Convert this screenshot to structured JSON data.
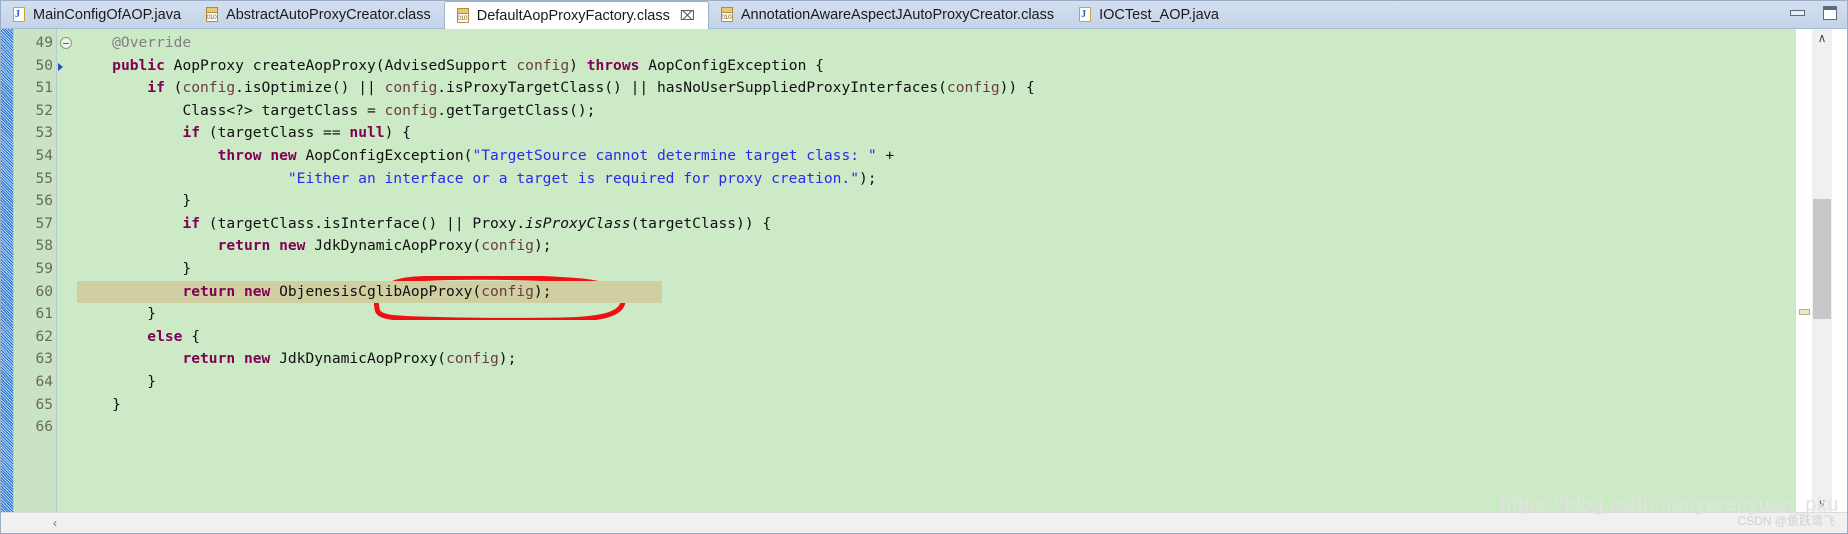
{
  "window": {
    "minimize_label": "Minimize",
    "maximize_label": "Maximize"
  },
  "tabs": [
    {
      "label": "MainConfigOfAOP.java",
      "icon": "java-file-icon",
      "active": false,
      "closable": false
    },
    {
      "label": "AbstractAutoProxyCreator.class",
      "icon": "class-file-icon",
      "active": false,
      "closable": false
    },
    {
      "label": "DefaultAopProxyFactory.class",
      "icon": "class-file-icon",
      "active": true,
      "closable": true,
      "close_glyph": "⌧"
    },
    {
      "label": "AnnotationAwareAspectJAutoProxyCreator.class",
      "icon": "class-file-icon",
      "active": false,
      "closable": false
    },
    {
      "label": "IOCTest_AOP.java",
      "icon": "java-file-icon",
      "active": false,
      "closable": false
    }
  ],
  "editor": {
    "first_line": 49,
    "last_line": 66,
    "highlighted_line": 60,
    "fold_line": 49,
    "cursor_line": 50,
    "colors": {
      "background": "#cdeac7",
      "highlight_row": "#cfcfa2",
      "gutter": "#c9e3c3",
      "keyword": "#7f0055",
      "string": "#2a2aee",
      "annotation": "#808080",
      "field": "#6a3e3e",
      "annotation_circle": "#ee1111"
    },
    "lines": [
      {
        "n": 49,
        "text": "    @Override"
      },
      {
        "n": 50,
        "text": "    public AopProxy createAopProxy(AdvisedSupport config) throws AopConfigException {"
      },
      {
        "n": 51,
        "text": "        if (config.isOptimize() || config.isProxyTargetClass() || hasNoUserSuppliedProxyInterfaces(config)) {"
      },
      {
        "n": 52,
        "text": "            Class<?> targetClass = config.getTargetClass();"
      },
      {
        "n": 53,
        "text": "            if (targetClass == null) {"
      },
      {
        "n": 54,
        "text": "                throw new AopConfigException(\"TargetSource cannot determine target class: \" +"
      },
      {
        "n": 55,
        "text": "                        \"Either an interface or a target is required for proxy creation.\");"
      },
      {
        "n": 56,
        "text": "            }"
      },
      {
        "n": 57,
        "text": "            if (targetClass.isInterface() || Proxy.isProxyClass(targetClass)) {"
      },
      {
        "n": 58,
        "text": "                return new JdkDynamicAopProxy(config);"
      },
      {
        "n": 59,
        "text": "            }"
      },
      {
        "n": 60,
        "text": "            return new ObjenesisCglibAopProxy(config);"
      },
      {
        "n": 61,
        "text": "        }"
      },
      {
        "n": 62,
        "text": "        else {"
      },
      {
        "n": 63,
        "text": "            return new JdkDynamicAopProxy(config);"
      },
      {
        "n": 64,
        "text": "        }"
      },
      {
        "n": 65,
        "text": "    }"
      },
      {
        "n": 66,
        "text": ""
      }
    ],
    "circled_text": "ObjenesisCglibAopProxy"
  },
  "scrollbars": {
    "vertical_up_glyph": "∧",
    "vertical_down_glyph": "∨",
    "horizontal_left_glyph": "‹"
  },
  "watermark": {
    "url": "https://blog.csdn.net/yerenyuan_pku",
    "badge": "CSDN @鱼跃鸢飞"
  }
}
